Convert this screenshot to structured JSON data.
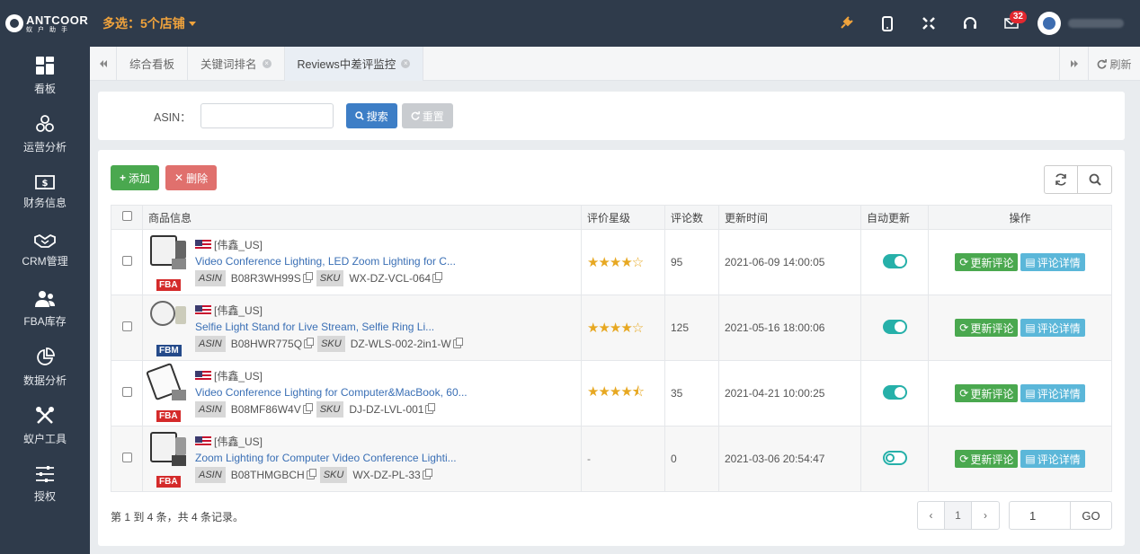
{
  "app": {
    "logo_main": "ANTCOOR",
    "logo_sub": "蚁户助手",
    "store_select": "多选：5个店铺"
  },
  "topbar": {
    "mail_badge": "32"
  },
  "sidebar": {
    "items": [
      {
        "label": "看板",
        "icon": "dashboard-icon"
      },
      {
        "label": "运营分析",
        "icon": "operations-icon"
      },
      {
        "label": "财务信息",
        "icon": "finance-icon"
      },
      {
        "label": "CRM管理",
        "icon": "crm-icon"
      },
      {
        "label": "FBA库存",
        "icon": "inventory-icon"
      },
      {
        "label": "数据分析",
        "icon": "analytics-icon"
      },
      {
        "label": "蚁户工具",
        "icon": "tools-icon"
      },
      {
        "label": "授权",
        "icon": "authorization-icon"
      }
    ]
  },
  "tabs": [
    {
      "label": "综合看板"
    },
    {
      "label": "关键词排名"
    },
    {
      "label": "Reviews中差评监控"
    }
  ],
  "tab_refresh": "刷新",
  "search": {
    "label": "ASIN：",
    "value": "",
    "search_btn": "搜索",
    "reset_btn": "重置"
  },
  "toolbar": {
    "add": "添加",
    "delete": "删除"
  },
  "table": {
    "headers": [
      "商品信息",
      "评价星级",
      "评论数",
      "更新时间",
      "自动更新",
      "操作"
    ],
    "asin_tag": "ASIN",
    "sku_tag": "SKU",
    "update_btn": "更新评论",
    "detail_btn": "评论详情",
    "rows": [
      {
        "store": "[伟鑫_US]",
        "title": "Video Conference Lighting, LED Zoom Lighting for C...",
        "asin": "B08R3WH99S",
        "sku": "WX-DZ-VCL-064",
        "fulfillment": "FBA",
        "stars": "★★★★☆",
        "rating": 4,
        "reviews": "95",
        "updated": "2021-06-09 14:00:05",
        "auto": true
      },
      {
        "store": "[伟鑫_US]",
        "title": "Selfie Light Stand for Live Stream, Selfie Ring Li...",
        "asin": "B08HWR775Q",
        "sku": "DZ-WLS-002-2in1-W",
        "fulfillment": "FBM",
        "stars": "★★★★☆",
        "rating": 4,
        "reviews": "125",
        "updated": "2021-05-16 18:00:06",
        "auto": true
      },
      {
        "store": "[伟鑫_US]",
        "title": "Video Conference Lighting for Computer&MacBook, 60...",
        "asin": "B08MF86W4V",
        "sku": "DJ-DZ-LVL-001",
        "fulfillment": "FBA",
        "stars": "★★★★⯪",
        "rating": 4.5,
        "reviews": "35",
        "updated": "2021-04-21 10:00:25",
        "auto": true
      },
      {
        "store": "[伟鑫_US]",
        "title": "Zoom Lighting for Computer Video Conference Lighti...",
        "asin": "B08THMGBCH",
        "sku": "WX-DZ-PL-33",
        "fulfillment": "FBA",
        "stars": "-",
        "rating": null,
        "reviews": "0",
        "updated": "2021-03-06 20:54:47",
        "auto": false
      }
    ]
  },
  "pager": {
    "info": "第 1 到 4 条，共 4 条记录。",
    "prev": "‹",
    "page": "1",
    "next": "›",
    "goto_value": "1",
    "go": "GO"
  },
  "colors": {
    "header_bg": "#2f3b4b",
    "accent_orange": "#f0a33c",
    "primary": "#3d7ec6",
    "success": "#4aa84f",
    "danger": "#e0706d",
    "toggle": "#26b0a9",
    "link": "#3a6fb5"
  }
}
